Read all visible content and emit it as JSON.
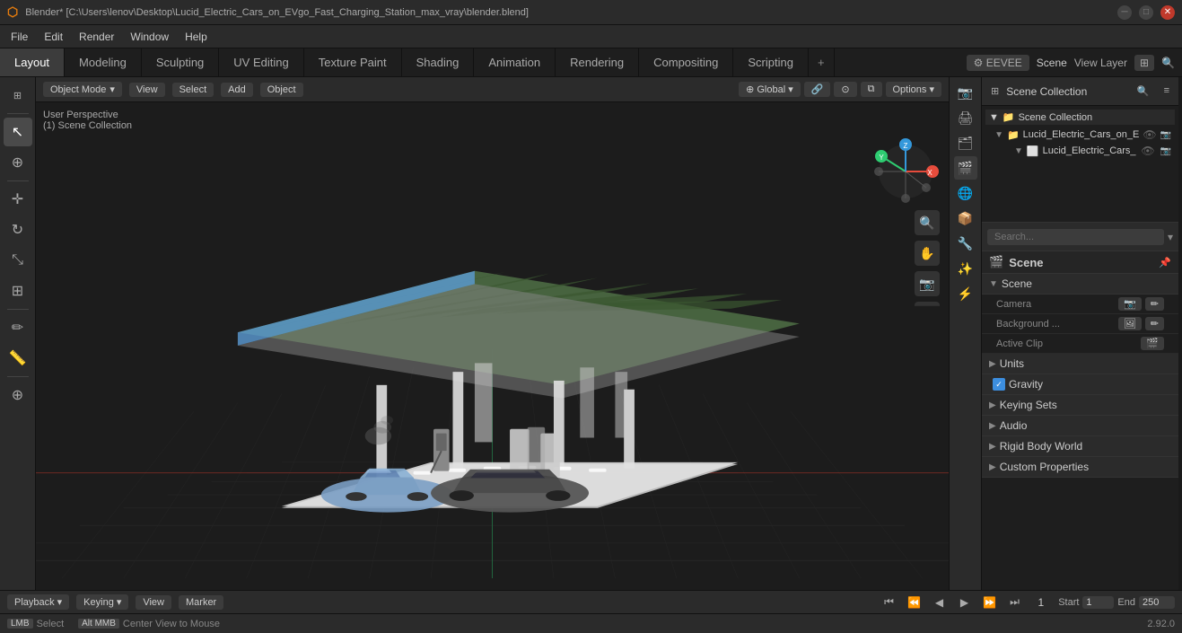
{
  "titlebar": {
    "logo": "⬡",
    "title": "Blender* [C:\\Users\\lenov\\Desktop\\Lucid_Electric_Cars_on_EVgo_Fast_Charging_Station_max_vray\\blender.blend]",
    "min": "─",
    "max": "□",
    "close": "✕"
  },
  "menubar": {
    "items": [
      "File",
      "Edit",
      "Render",
      "Window",
      "Help"
    ]
  },
  "tabs": {
    "items": [
      "Layout",
      "Modeling",
      "Sculpting",
      "UV Editing",
      "Texture Paint",
      "Shading",
      "Animation",
      "Rendering",
      "Compositing",
      "Scripting"
    ],
    "active": "Layout",
    "right_label": "View Layer",
    "scene_label": "Scene"
  },
  "viewport": {
    "mode": "Object Mode",
    "view_label": "View",
    "select_label": "Select",
    "add_label": "Add",
    "object_label": "Object",
    "transform": "Global",
    "options_label": "Options",
    "camera_label": "User Perspective",
    "collection_label": "(1) Scene Collection"
  },
  "outliner": {
    "title": "Scene Collection",
    "items": [
      {
        "indent": 0,
        "icon": "▼",
        "label": "Lucid_Electric_Cars_on_E",
        "visible": true
      },
      {
        "indent": 1,
        "icon": "▼",
        "label": "Lucid_Electric_Cars_",
        "visible": true
      }
    ]
  },
  "properties": {
    "title": "Scene",
    "scene_section": "Scene",
    "camera_label": "Camera",
    "background_label": "Background ...",
    "active_clip_label": "Active Clip",
    "units_label": "Units",
    "gravity_label": "Gravity",
    "gravity_checked": true,
    "keying_sets_label": "Keying Sets",
    "audio_label": "Audio",
    "rigid_body_label": "Rigid Body World",
    "custom_props_label": "Custom Properties"
  },
  "timeline": {
    "playback_label": "Playback",
    "keying_label": "Keying",
    "view_label": "View",
    "marker_label": "Marker",
    "current_frame": "1",
    "start_label": "Start",
    "start_value": "1",
    "end_label": "End",
    "end_value": "250"
  },
  "status": {
    "select_label": "Select",
    "center_label": "Center View to Mouse",
    "version": "2.92.0"
  },
  "icons": {
    "cursor": "⊕",
    "move": "✛",
    "rotate": "↻",
    "scale": "⤡",
    "transform": "⊞",
    "measure": "📐",
    "add_cube": "⊕",
    "scene": "🎬",
    "camera": "📷",
    "background": "🖼",
    "clip": "🎬",
    "pin": "📌",
    "eye": "👁",
    "chevron_right": "▶",
    "chevron_down": "▼"
  }
}
